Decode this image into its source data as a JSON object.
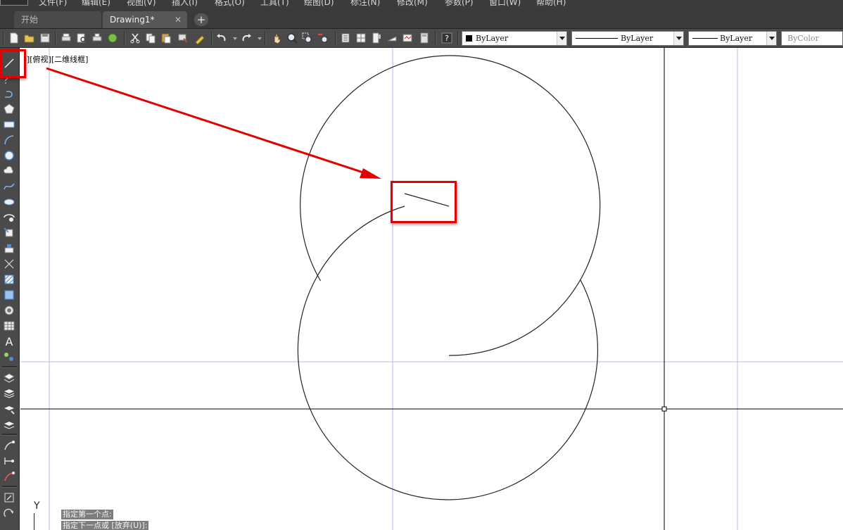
{
  "menu": {
    "items": [
      "文件(F)",
      "编辑(E)",
      "视图(V)",
      "插入(I)",
      "格式(O)",
      "工具(T)",
      "绘图(D)",
      "标注(N)",
      "修改(M)",
      "参数(P)",
      "窗口(W)",
      "帮助(H)"
    ]
  },
  "tabs": {
    "items": [
      {
        "label": "开始",
        "active": false
      },
      {
        "label": "Drawing1*",
        "active": true,
        "close": "✕"
      }
    ],
    "add_label": "+"
  },
  "properties": {
    "color": "ByLayer",
    "linetype": "ByLayer",
    "lineweight": "ByLayer",
    "plotstyle": "ByColor"
  },
  "toolbar_icons": [
    "new-icon",
    "open-icon",
    "save-icon",
    "plot-icon",
    "plot-preview-icon",
    "publish-icon",
    "3d-print-icon",
    "cut-icon",
    "copy-icon",
    "paste-icon",
    "match-properties-icon",
    "block-editor-icon",
    "undo-icon",
    "redo-icon",
    "pan-icon",
    "zoom-realtime-icon",
    "zoom-window-icon",
    "zoom-previous-icon",
    "properties-icon",
    "design-center-icon",
    "tool-palettes-icon",
    "sheet-set-icon",
    "markup-icon",
    "calculator-icon",
    "help-icon"
  ],
  "draw_tools": [
    "line-icon",
    "construction-line-icon",
    "polyline-icon",
    "polygon-icon",
    "rectangle-icon",
    "arc-icon",
    "circle-icon",
    "revision-cloud-icon",
    "spline-icon",
    "ellipse-icon",
    "ellipse-arc-icon",
    "insert-block-icon",
    "make-block-icon",
    "point-icon",
    "hatch-icon",
    "gradient-icon",
    "region-icon",
    "table-icon",
    "multiline-text-icon",
    "add-selected-icon",
    "layer-properties-icon",
    "layer-state-icon",
    "make-object-layer-current-icon",
    "layer-previous-icon",
    "dim-linear-icon",
    "dim-aligned-icon",
    "dim-radius-icon",
    "modify-move-icon",
    "modify-rotate-icon"
  ],
  "viewport": {
    "label": "-][俯视][二维线框]"
  },
  "ucs": {
    "y_label": "Y"
  },
  "command": {
    "line1": "指定第一个点:",
    "line2": "指定下一点或 [放弃(U)]:"
  },
  "colors": {
    "annotation_red": "#e30000",
    "ui_dark": "#4a4a4a",
    "canvas_bg": "#ffffff"
  }
}
